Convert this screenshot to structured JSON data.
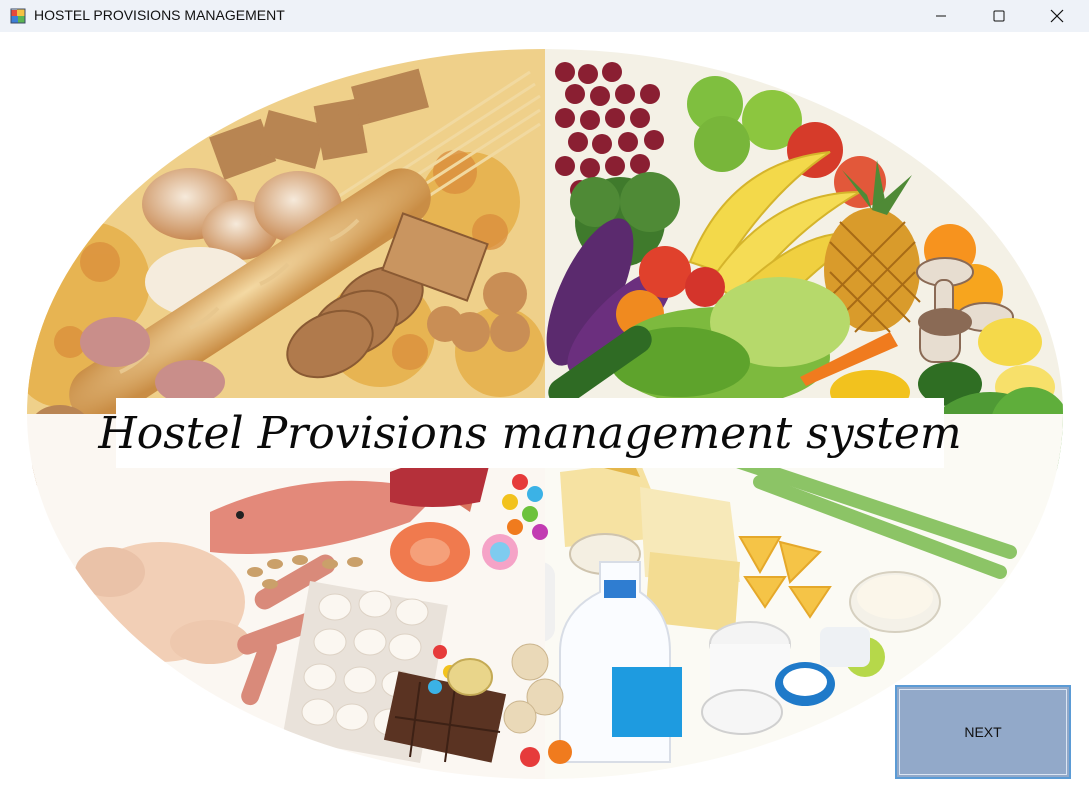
{
  "window": {
    "title": "HOSTEL PROVISIONS MANAGEMENT",
    "icon": "app-window-icon",
    "controls": {
      "minimize": "minimize-icon",
      "maximize": "maximize-icon",
      "close": "close-icon"
    }
  },
  "main": {
    "banner_text": "Hostel Provisions management system",
    "next_label": "NEXT",
    "background_image": "food-groups-plate-illustration"
  },
  "colors": {
    "titlebar": "#eef2f8",
    "button_fill": "#92a9c9",
    "button_border": "#5b9bd5",
    "banner_bg": "#ffffff"
  }
}
